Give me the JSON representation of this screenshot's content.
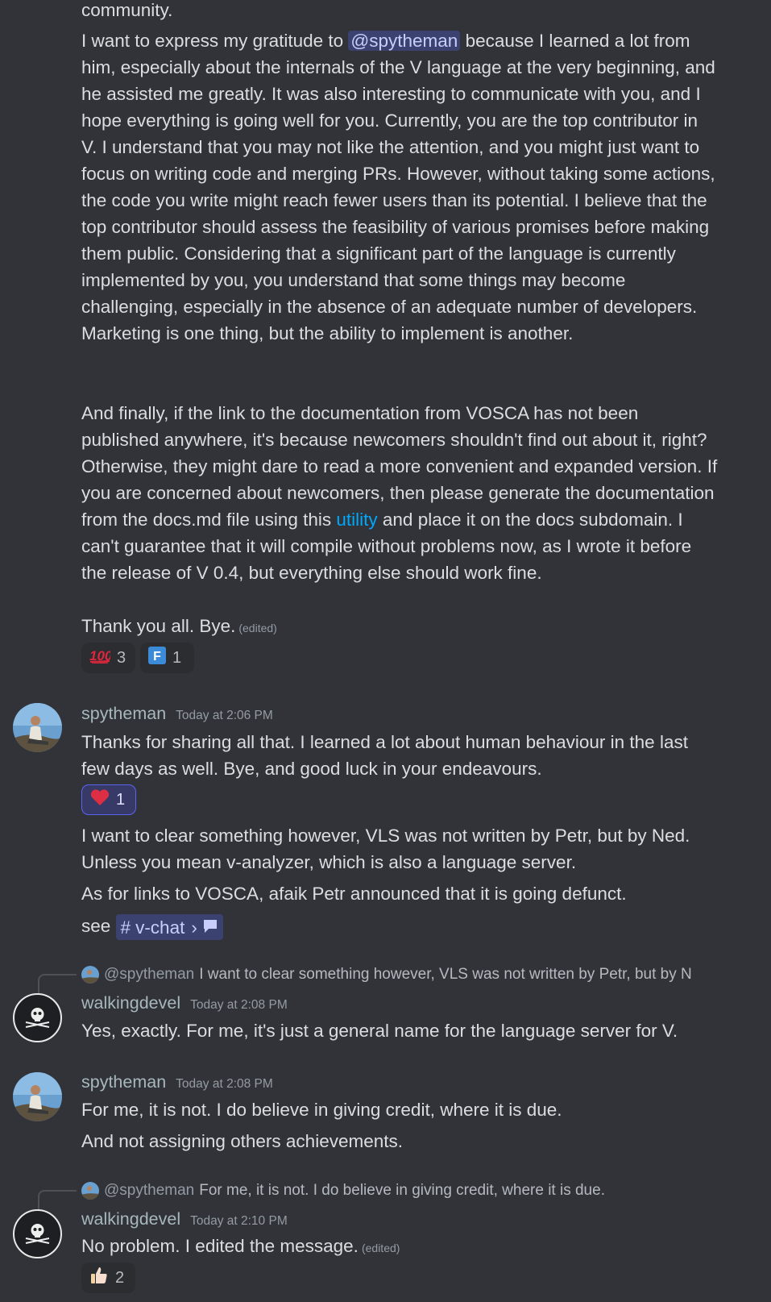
{
  "top_fragment": "community.",
  "msg1": {
    "p1_before": "I want to express my gratitude to ",
    "p1_mention": "@spytheman",
    "p1_after": " because I learned a lot from him, especially about the internals of the V language at the very beginning, and he assisted me greatly. It was also interesting to communicate with you, and I hope everything is going well for you. Currently, you are the top contributor in V. I understand that you may not like the attention, and you might just want to focus on writing code and merging PRs. However, without taking some actions, the code you write might reach fewer users than its potential. I believe that the top contributor should assess the feasibility of various promises before making them public. Considering that a significant part of the language is currently implemented by you, you understand that some things may become challenging, especially in the absence of an adequate number of developers. Marketing is one thing, but the ability to implement is another.",
    "p2_before": "And finally, if the link to the documentation from VOSCA has not been published anywhere, it's because newcomers shouldn't find out about it, right? Otherwise, they might dare to read a more convenient and expanded version. If you are concerned about newcomers, then please generate the documentation from the docs.md file using this ",
    "p2_link": "utility",
    "p2_after": " and place it on the docs subdomain. I can't guarantee that it will compile without problems now, as I wrote it before the release of V 0.4, but everything else should work fine.",
    "p3": "Thank you all. Bye.",
    "edited": "(edited)",
    "reactions": [
      {
        "emoji": "100-icon",
        "count": "3"
      },
      {
        "emoji": "regional-f-icon",
        "count": "1"
      }
    ]
  },
  "msg2": {
    "username": "spytheman",
    "timestamp": "Today at 2:06 PM",
    "text": "Thanks for sharing all that. I learned a lot about human behaviour in the last few days as well. Bye, and good luck in your endeavours.",
    "reaction": {
      "emoji": "heart-icon",
      "count": "1"
    },
    "follow1": "I want to clear something however, VLS was not written by Petr, but by Ned. Unless you mean v-analyzer, which is also a language server.",
    "follow2": "As for links to VOSCA, afaik Petr announced that it is going defunct.",
    "see_label": "see",
    "channel_hash": "#",
    "channel_name": "v-chat",
    "channel_chevron": "›"
  },
  "msg3": {
    "reply_user": "@spytheman",
    "reply_text": "I want to clear something however, VLS was not written by Petr, but by N",
    "username": "walkingdevel",
    "timestamp": "Today at 2:08 PM",
    "text": "Yes, exactly. For me, it's just a general name for the language server for V."
  },
  "msg4": {
    "username": "spytheman",
    "timestamp": "Today at 2:08 PM",
    "text1": "For me, it is not. I do believe in giving credit, where it is due.",
    "text2": "And not assigning others achievements."
  },
  "msg5": {
    "reply_user": "@spytheman",
    "reply_text": "For me, it is not. I do believe in giving credit, where it is due.",
    "username": "walkingdevel",
    "timestamp": "Today at 2:10 PM",
    "text": "No problem. I edited the message.",
    "edited": "(edited)",
    "reaction": {
      "emoji": "thumbs-up-icon",
      "count": "2"
    }
  },
  "colors": {
    "background": "#313338",
    "mention_bg": "#3c4270",
    "link": "#00a8fc",
    "username": "#a7b8bd"
  }
}
